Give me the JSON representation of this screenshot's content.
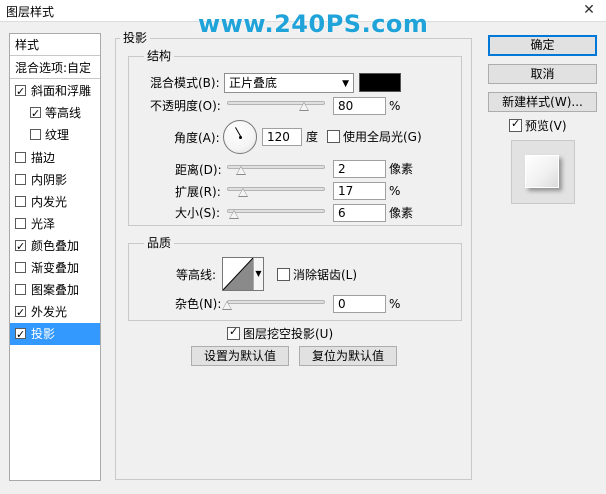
{
  "window": {
    "title": "图层样式",
    "watermark": "www.240PS.com",
    "close_label": "✕"
  },
  "left_panel": {
    "header": "样式",
    "blend_options": "混合选项:自定",
    "items": [
      {
        "label": "斜面和浮雕",
        "checked": true
      },
      {
        "label": "等高线",
        "checked": true
      },
      {
        "label": "纹理",
        "checked": false
      },
      {
        "label": "描边",
        "checked": false
      },
      {
        "label": "内阴影",
        "checked": false
      },
      {
        "label": "内发光",
        "checked": false
      },
      {
        "label": "光泽",
        "checked": false
      },
      {
        "label": "颜色叠加",
        "checked": true
      },
      {
        "label": "渐变叠加",
        "checked": false
      },
      {
        "label": "图案叠加",
        "checked": false
      },
      {
        "label": "外发光",
        "checked": true
      },
      {
        "label": "投影",
        "checked": true,
        "selected": true
      }
    ]
  },
  "drop_shadow": {
    "section_title": "投影",
    "structure": {
      "title": "结构",
      "blend_mode_label": "混合模式(B):",
      "blend_mode_value": "正片叠底",
      "shadow_color": "#000000",
      "opacity_label": "不透明度(O):",
      "opacity_value": "80",
      "opacity_unit": "%",
      "angle_label": "角度(A):",
      "angle_value": "120",
      "angle_unit": "度",
      "global_light_label": "使用全局光(G)",
      "global_light_checked": false,
      "distance_label": "距离(D):",
      "distance_value": "2",
      "distance_unit": "像素",
      "spread_label": "扩展(R):",
      "spread_value": "17",
      "spread_unit": "%",
      "size_label": "大小(S):",
      "size_value": "6",
      "size_unit": "像素"
    },
    "quality": {
      "title": "品质",
      "contour_label": "等高线:",
      "antialias_label": "消除锯齿(L)",
      "antialias_checked": false,
      "noise_label": "杂色(N):",
      "noise_value": "0",
      "noise_unit": "%"
    },
    "knockout_label": "图层挖空投影(U)",
    "knockout_checked": true,
    "make_default_label": "设置为默认值",
    "reset_default_label": "复位为默认值"
  },
  "buttons": {
    "ok": "确定",
    "cancel": "取消",
    "new_style": "新建样式(W)...",
    "preview_label": "预览(V)",
    "preview_checked": true
  }
}
